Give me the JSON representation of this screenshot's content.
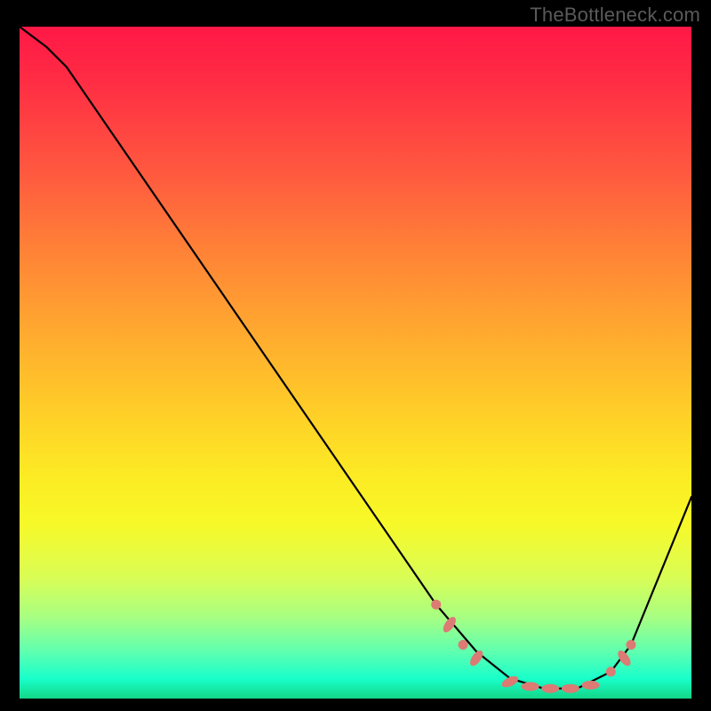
{
  "watermark": "TheBottleneck.com",
  "chart_data": {
    "type": "line",
    "title": "",
    "xlabel": "",
    "ylabel": "",
    "xlim": [
      0,
      100
    ],
    "ylim": [
      0,
      100
    ],
    "series": [
      {
        "name": "curve",
        "x": [
          0,
          4,
          7,
          62,
          68,
          73,
          78,
          83,
          88,
          91,
          100
        ],
        "y": [
          100,
          97,
          94,
          14,
          7,
          3,
          1.5,
          1.5,
          4,
          8,
          30
        ],
        "color": "#000000"
      }
    ],
    "markers": [
      {
        "x": 62,
        "y": 14,
        "shape": "dot",
        "color": "#dc7a73"
      },
      {
        "x": 64,
        "y": 11,
        "shape": "lozenge",
        "color": "#dc7a73"
      },
      {
        "x": 66,
        "y": 8,
        "shape": "dot",
        "color": "#dc7a73"
      },
      {
        "x": 68,
        "y": 6,
        "shape": "lozenge",
        "color": "#dc7a73"
      },
      {
        "x": 73,
        "y": 2.5,
        "shape": "lozenge",
        "color": "#dc7a73"
      },
      {
        "x": 76,
        "y": 1.8,
        "shape": "lozenge",
        "color": "#dc7a73"
      },
      {
        "x": 79,
        "y": 1.5,
        "shape": "lozenge",
        "color": "#dc7a73"
      },
      {
        "x": 82,
        "y": 1.5,
        "shape": "lozenge",
        "color": "#dc7a73"
      },
      {
        "x": 85,
        "y": 2,
        "shape": "lozenge",
        "color": "#dc7a73"
      },
      {
        "x": 88,
        "y": 4,
        "shape": "dot",
        "color": "#dc7a73"
      },
      {
        "x": 90,
        "y": 6,
        "shape": "lozenge",
        "color": "#dc7a73"
      },
      {
        "x": 91,
        "y": 8,
        "shape": "dot",
        "color": "#dc7a73"
      }
    ],
    "background_gradient": {
      "top_color": "#ff1846",
      "mid_color": "#ffd027",
      "bottom_color": "#12d687"
    }
  }
}
